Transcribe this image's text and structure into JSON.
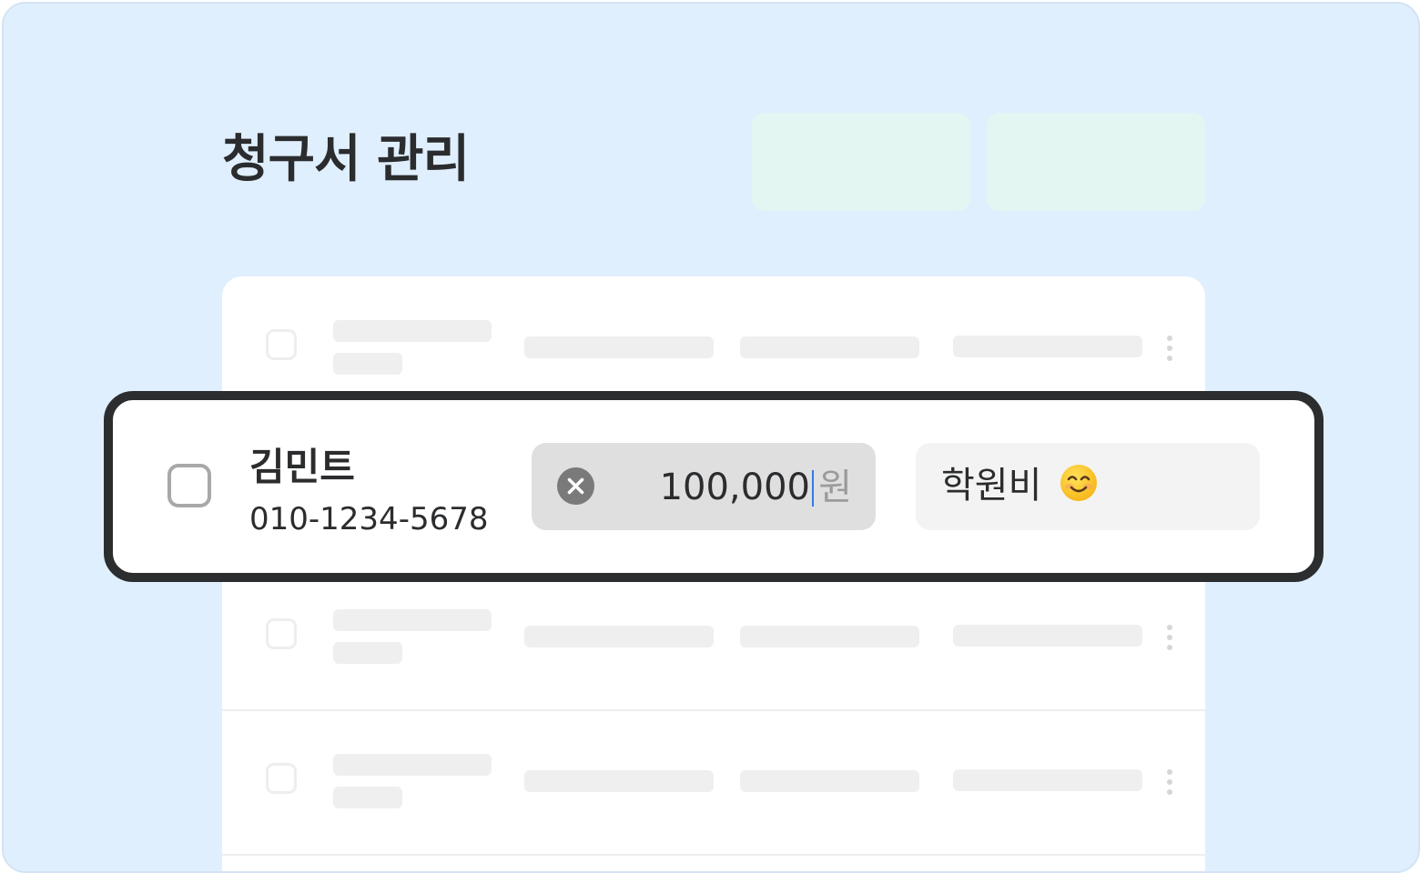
{
  "page": {
    "title": "청구서 관리",
    "accent_color": "#E3F6F2",
    "background_color": "#E0EFFE"
  },
  "header": {
    "action_buttons": [
      {
        "label": "",
        "color": "#E3F6F2"
      },
      {
        "label": "",
        "color": "#E3F6F2"
      }
    ]
  },
  "invoice_row": {
    "customer_name": "김민트",
    "phone": "010-1234-5678",
    "amount": {
      "value": "100,000",
      "unit": "원",
      "clear_icon": "close-circle-icon"
    },
    "memo": {
      "value": "학원비",
      "emoji_icon": "smiling-face-icon"
    }
  },
  "placeholder_rows": [
    {
      "state": "loading"
    },
    {
      "state": "loading"
    },
    {
      "state": "loading"
    }
  ]
}
